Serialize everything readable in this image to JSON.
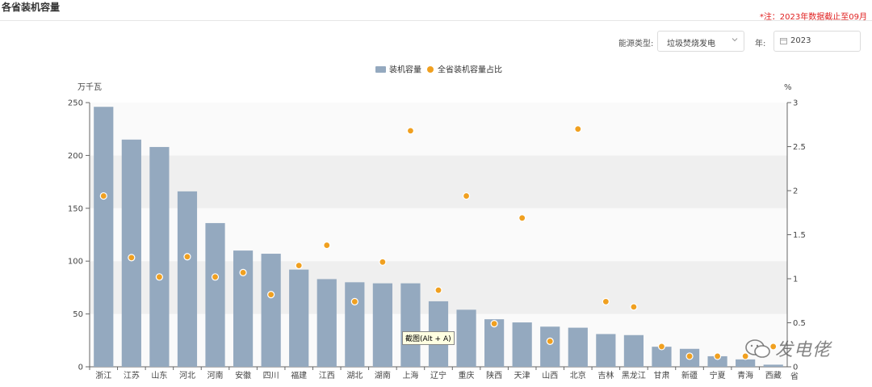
{
  "title": "各省装机容量",
  "note": "*注：2023年数据截止至09月",
  "filters": {
    "energy_label": "能源类型:",
    "energy_value": "垃圾焚烧发电",
    "year_label": "年:",
    "year_value": "2023"
  },
  "tooltip": "截图(Alt + A)",
  "watermark": "发电佬",
  "colors": {
    "bar": "#94a9bf",
    "dot": "#f0a020",
    "band": "#efefef",
    "band_light": "#fafafa"
  },
  "chart_data": {
    "type": "bar",
    "legend": [
      "装机容量",
      "全省装机容量占比"
    ],
    "legend_position": "top-center",
    "y_left_label": "万千瓦",
    "y_right_label": "%",
    "x_axis_name": "省",
    "y_left_ticks": [
      "0",
      "50",
      "100",
      "150",
      "200",
      "250"
    ],
    "y_right_ticks": [
      "0",
      "0.5",
      "1",
      "1.5",
      "2",
      "2.5",
      "3"
    ],
    "ylim_left": [
      0,
      250
    ],
    "ylim_right": [
      0,
      3
    ],
    "categories": [
      "浙江",
      "江苏",
      "山东",
      "河北",
      "河南",
      "安徽",
      "四川",
      "福建",
      "江西",
      "湖北",
      "湖南",
      "上海",
      "辽宁",
      "重庆",
      "陕西",
      "天津",
      "山西",
      "北京",
      "吉林",
      "黑龙江",
      "甘肃",
      "新疆",
      "宁夏",
      "青海",
      "西藏"
    ],
    "series": [
      {
        "name": "装机容量",
        "axis": "left",
        "values": [
          246,
          215,
          208,
          166,
          136,
          110,
          107,
          92,
          83,
          80,
          79,
          79,
          62,
          54,
          45,
          42,
          38,
          37,
          31,
          30,
          19,
          17,
          10,
          7,
          2
        ]
      },
      {
        "name": "全省装机容量占比",
        "axis": "right",
        "values": [
          1.94,
          1.24,
          1.02,
          1.25,
          1.02,
          1.07,
          0.82,
          1.15,
          1.38,
          0.74,
          1.19,
          2.68,
          0.87,
          1.94,
          0.49,
          1.69,
          0.29,
          2.7,
          0.74,
          0.68,
          0.23,
          0.12,
          0.12,
          0.12,
          0.23
        ]
      }
    ]
  }
}
